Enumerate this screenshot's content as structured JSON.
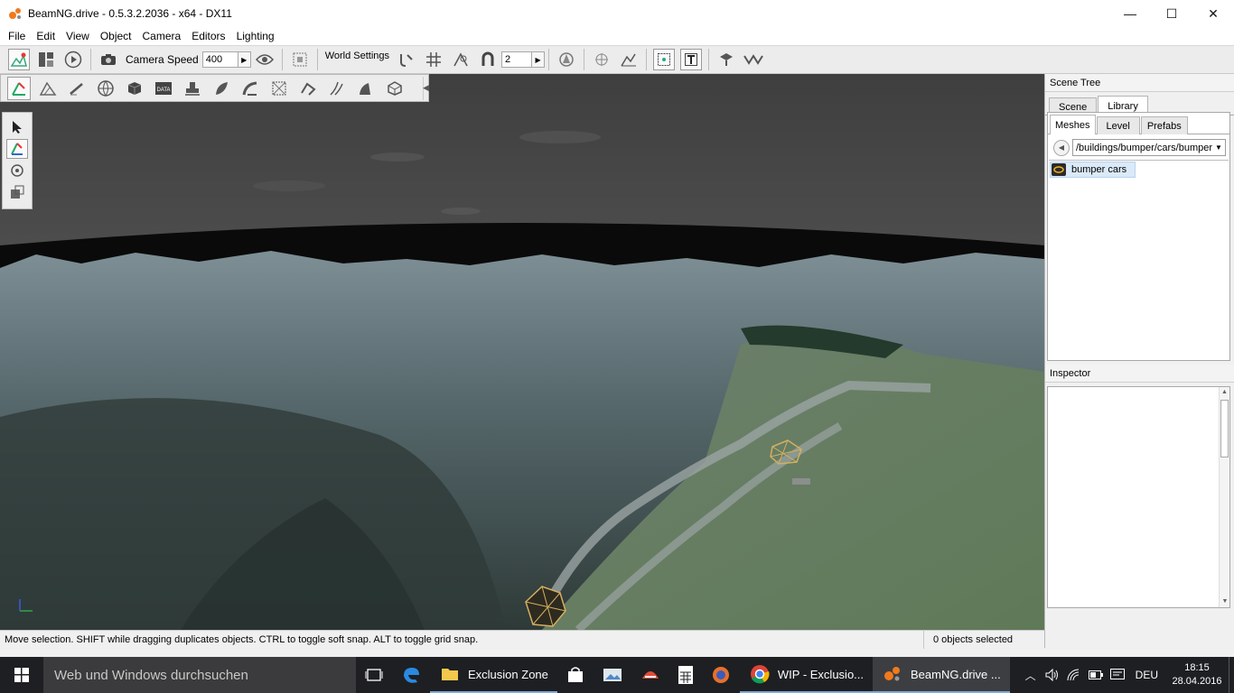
{
  "window": {
    "title": "BeamNG.drive - 0.5.3.2.2036 - x64 - DX11",
    "minimize": "—",
    "maximize": "☐",
    "close": "✕"
  },
  "menu": [
    "File",
    "Edit",
    "View",
    "Object",
    "Camera",
    "Editors",
    "Lighting"
  ],
  "toolbar": {
    "camera_speed_label": "Camera Speed",
    "camera_speed_value": "400",
    "world_settings_label": "World Settings",
    "grid_value": "2"
  },
  "status": {
    "message": "Move selection.  SHIFT while dragging duplicates objects.  CTRL to toggle soft snap.  ALT to toggle grid snap.",
    "selection_count": "0 objects selected"
  },
  "scene_tree": {
    "title": "Scene Tree",
    "tabs": [
      "Scene",
      "Library"
    ],
    "active_tab": "Library",
    "subtabs": [
      "Meshes",
      "Level",
      "Prefabs"
    ],
    "active_subtab": "Meshes",
    "path": "/buildings/bumper/cars/bumper",
    "items": [
      "bumper cars"
    ]
  },
  "inspector": {
    "title": "Inspector"
  },
  "taskbar": {
    "search_placeholder": "Web und Windows durchsuchen",
    "tasks": [
      {
        "label": "Exclusion Zone",
        "icon": "folder-icon"
      },
      {
        "label": "WIP - Exclusio...",
        "icon": "chrome-icon"
      },
      {
        "label": "BeamNG.drive ...",
        "icon": "beamng-icon"
      }
    ],
    "language": "DEU",
    "time": "18:15",
    "date": "28.04.2016"
  },
  "colors": {
    "accent": "#f07a1c",
    "taskbar": "#1e1f22",
    "selection": "#dbeaf8"
  }
}
